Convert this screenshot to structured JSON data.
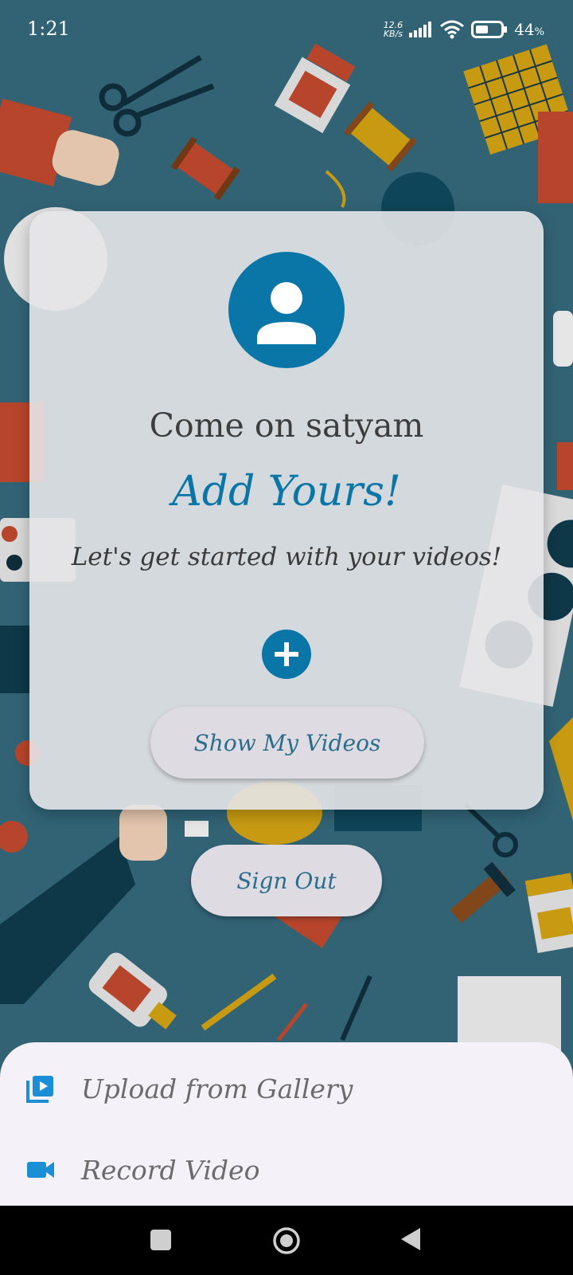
{
  "status_bar": {
    "time": "1:21",
    "net_speed_value": "12.6",
    "net_speed_unit": "KB/s",
    "battery_percent": "44",
    "battery_suffix": "%"
  },
  "card": {
    "greeting": "Come on satyam",
    "headline": "Add Yours!",
    "subtitle": "Let's get started with your videos!",
    "add_icon": "plus-icon",
    "show_videos_label": "Show My Videos"
  },
  "sign_out_label": "Sign Out",
  "bottom_sheet": {
    "items": [
      {
        "label": "Upload from Gallery",
        "icon": "video-library-icon"
      },
      {
        "label": "Record Video",
        "icon": "videocam-icon"
      }
    ]
  },
  "nav_bar": {
    "recents_icon": "square-icon",
    "home_icon": "circle-icon",
    "back_icon": "triangle-back-icon"
  },
  "colors": {
    "accent": "#0a76a8",
    "background": "#356a7d",
    "sheet": "#f4f1f8",
    "sheet_icon": "#1a8fd6"
  }
}
